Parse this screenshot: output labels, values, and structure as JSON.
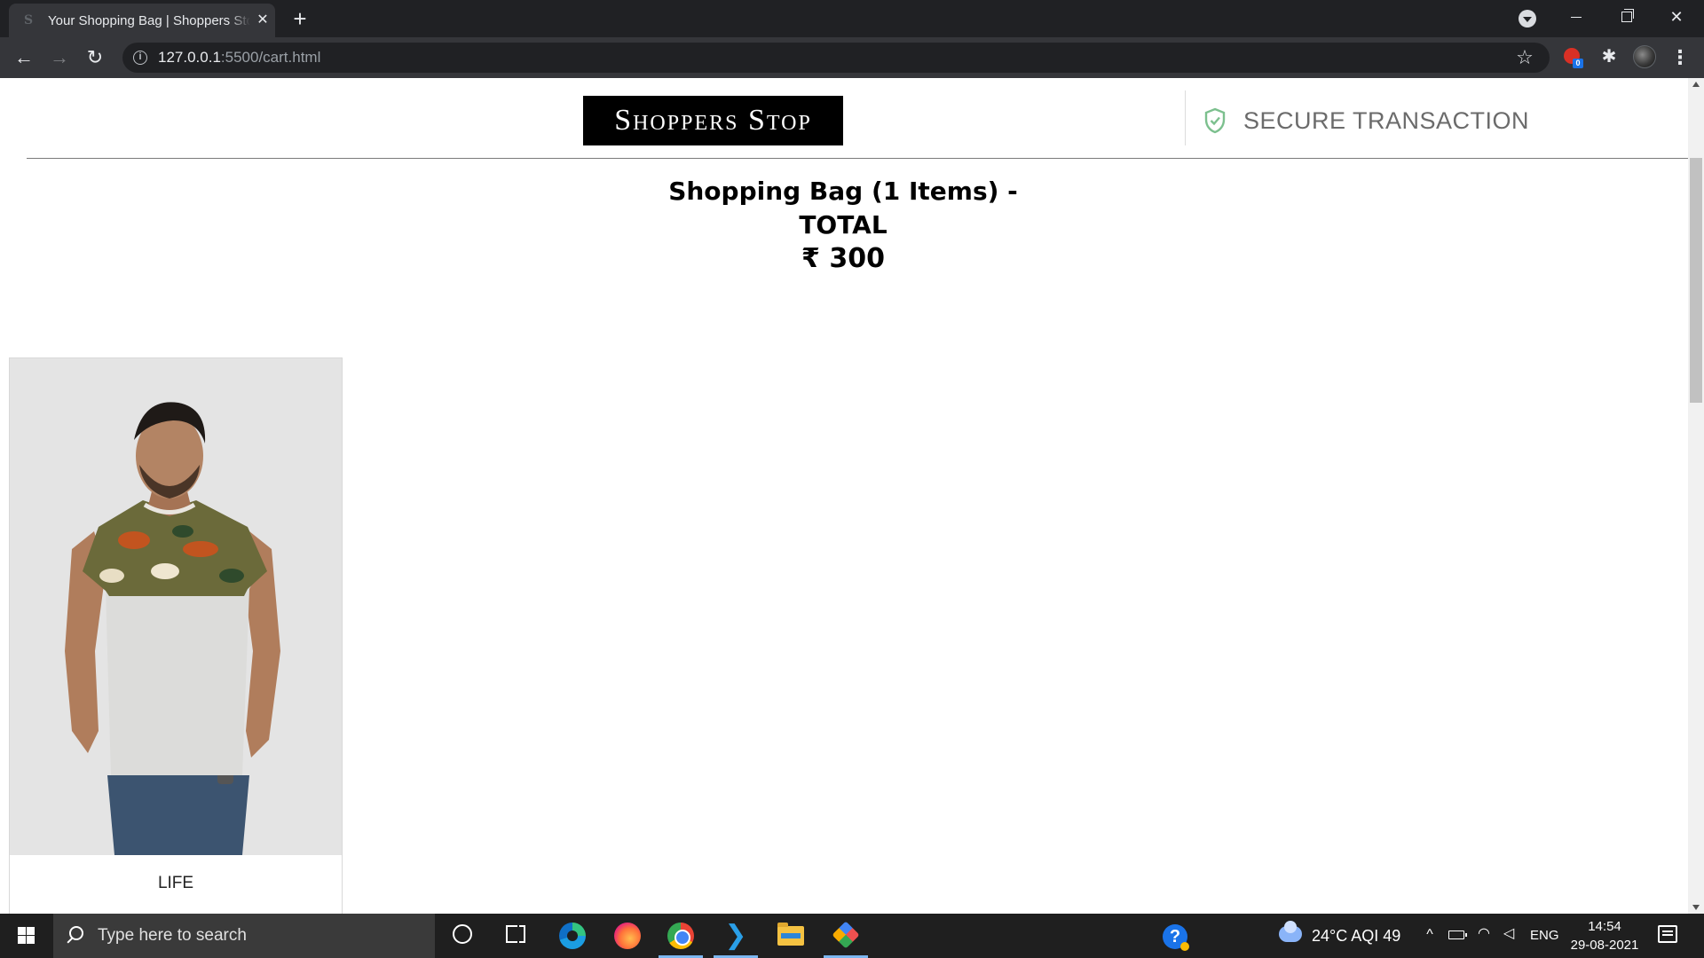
{
  "browser": {
    "tab_title": "Your Shopping Bag | Shoppers Stop",
    "tab_favicon": "S",
    "url_host": "127.0.0.1",
    "url_rest": ":5500/cart.html",
    "icons": {
      "back": "back-arrow-icon",
      "forward": "forward-arrow-icon",
      "reload": "reload-icon",
      "info": "info-icon",
      "bookmark": "star-icon",
      "extension_badge": "0"
    }
  },
  "header": {
    "logo_text": "Shoppers Stop",
    "secure_text": "SECURE TRANSACTION",
    "shield_color": "#7cc08e"
  },
  "cart": {
    "title": "Shopping Bag (1 Items) -",
    "total_label": "TOTAL",
    "total_amount": "₹ 300"
  },
  "products": [
    {
      "brand": "LIFE"
    }
  ],
  "taskbar": {
    "search_placeholder": "Type here to search",
    "weather": "24°C  AQI 49",
    "language": "ENG",
    "time": "14:54",
    "date": "29-08-2021",
    "apps": [
      "cortana-icon",
      "task-view-icon",
      "edge-icon",
      "firefox-icon",
      "chrome-icon",
      "vscode-icon",
      "file-explorer-icon",
      "git-icon"
    ]
  }
}
